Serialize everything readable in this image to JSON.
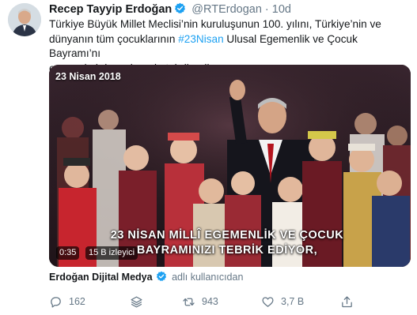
{
  "tweet": {
    "author_name": "Recep Tayyip Erdoğan",
    "handle": "@RTErdogan",
    "separator": "·",
    "time": "10d",
    "text_line1": "Türkiye Büyük Millet Meclisi’nin kuruluşunun 100. yılını, Türkiye’nin ve",
    "text_line2_pre": "dünyanın tüm çocuklarının ",
    "hashtag": "#23Nisan",
    "text_line2_post": " Ulusal Egemenlik ve Çocuk Bayramı’nı",
    "text_line3": "en samimi duygularımla tebrik ediyorum."
  },
  "video": {
    "date_caption": "23 Nisan 2018",
    "subtitle_line1": "23 NİSAN MİLLÎ EGEMENLİK VE ÇOCUK",
    "subtitle_line2": "BAYRAMINIZI TEBRİK EDİYOR,",
    "duration": "0:35",
    "views": "15 B izleyici"
  },
  "source": {
    "name": "Erdoğan Dijital Medya",
    "suffix": "adlı kullanıcıdan"
  },
  "actions": {
    "reply_count": "162",
    "retweet_count": "943",
    "like_count": "3,7 B"
  },
  "icons": {
    "verified": "verified-badge-icon",
    "reply": "reply-icon",
    "stack": "layers-icon",
    "retweet": "retweet-icon",
    "like": "heart-icon",
    "share": "share-icon"
  },
  "colors": {
    "link": "#1da1f2",
    "secondary_text": "#657786",
    "primary_text": "#14171a"
  }
}
